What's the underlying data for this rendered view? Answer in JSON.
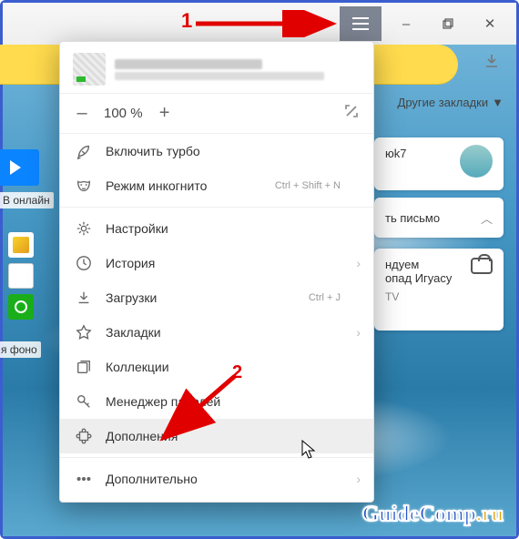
{
  "window": {
    "hamburger_icon": "hamburger",
    "minimize": "–",
    "maximize": "◻",
    "close": "✕"
  },
  "toolbar": {
    "download_icon": "↓",
    "other_bookmarks": "Другие закладки"
  },
  "left": {
    "online_label": "В онлайн",
    "fono_label": "я фоно"
  },
  "right": {
    "card1_text": "юk7",
    "card2_text": "ть письмо",
    "card3_line1": "ндуем",
    "card3_line2": "опад Игуасу",
    "card3_line3": "TV"
  },
  "zoom": {
    "minus": "–",
    "value": "100 %",
    "plus": "+"
  },
  "menu": {
    "turbo": "Включить турбо",
    "incognito": "Режим инкогнито",
    "incognito_shortcut": "Ctrl + Shift + N",
    "settings": "Настройки",
    "history": "История",
    "downloads": "Загрузки",
    "downloads_shortcut": "Ctrl + J",
    "bookmarks": "Закладки",
    "collections": "Коллекции",
    "passwords": "Менеджер паролей",
    "addons": "Дополнения",
    "more": "Дополнительно"
  },
  "annotations": {
    "n1": "1",
    "n2": "2"
  },
  "watermark": {
    "main": "GuideComp",
    "suffix": ".ru"
  }
}
